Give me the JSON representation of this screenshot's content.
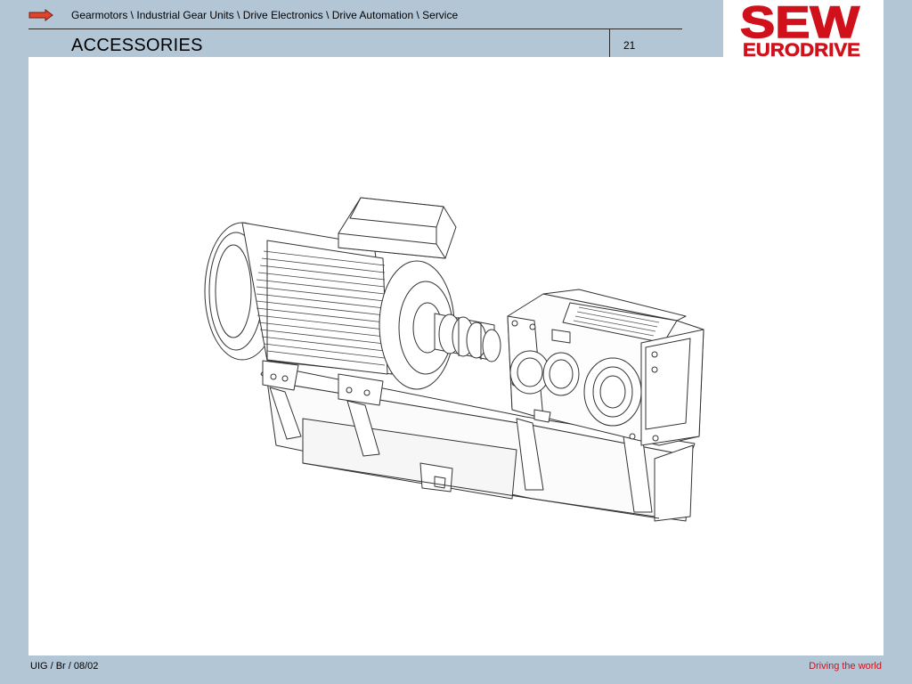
{
  "header": {
    "breadcrumb": "Gearmotors \\ Industrial Gear Units \\ Drive Electronics \\ Drive Automation \\ Service",
    "title": "ACCESSORIES",
    "page_number": "21"
  },
  "logo": {
    "line1": "SEW",
    "line2": "EURODRIVE",
    "color": "#d0111b"
  },
  "footer": {
    "left": "UIG / Br / 08/02",
    "right": "Driving the world"
  },
  "colors": {
    "background": "#b3c6d6",
    "accent_red": "#d0111b",
    "arrow_fill": "#e0442a"
  },
  "illustration": {
    "subject_icon": "gearmotor-line-drawing"
  }
}
